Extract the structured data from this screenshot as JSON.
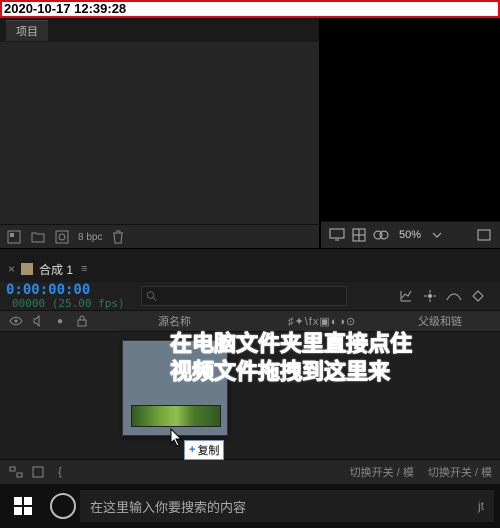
{
  "timestamp": "2020-10-17 12:39:28",
  "project": {
    "tab_label": "项目",
    "bpc": "8 bpc"
  },
  "preview": {
    "zoom": "50%"
  },
  "timeline": {
    "comp_name": "合成 1",
    "menu_indicator": "≡",
    "timecode": "0:00:00:00",
    "fps_line": "00000 (25.00 fps)",
    "search_placeholder": "",
    "columns": {
      "source_name": "源名称",
      "switches": "♯✦\\fx▣◐◑⊙",
      "parent": "父级和链"
    },
    "footer": {
      "toggle_a": "切换开关 / 模",
      "toggle_b": "切换开关 / 模"
    }
  },
  "drag_copy_label": "复制",
  "annotation": {
    "line1": "在电脑文件夹里直接点住",
    "line2": "视频文件拖拽到这里来"
  },
  "taskbar": {
    "search_placeholder": "在这里输入你要搜索的内容",
    "mic_hint": "jt"
  },
  "icons": {
    "search": "search-icon",
    "trash": "trash-icon",
    "folder": "folder-icon",
    "monitor": "monitor-icon",
    "mask": "mask-icon",
    "grid": "grid-icon",
    "dropdown": "chevron-down-icon"
  }
}
